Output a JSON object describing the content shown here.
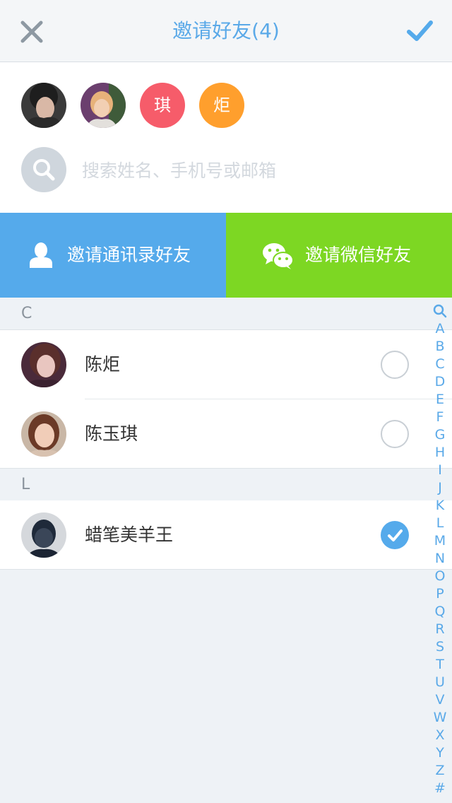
{
  "header": {
    "title": "邀请好友(4)"
  },
  "selected": {
    "chips": [
      {
        "type": "photo",
        "name": "avatar-photo-1"
      },
      {
        "type": "photo",
        "name": "avatar-photo-2"
      },
      {
        "type": "text",
        "text": "琪",
        "color": "#f65c6a"
      },
      {
        "type": "text",
        "text": "炬",
        "color": "#ff9f2d"
      }
    ]
  },
  "search": {
    "placeholder": "搜索姓名、手机号或邮箱"
  },
  "invite": {
    "contacts_label": "邀请通讯录好友",
    "wechat_label": "邀请微信好友"
  },
  "sections": [
    {
      "letter": "C",
      "contacts": [
        {
          "name": "陈炬",
          "checked": false
        },
        {
          "name": "陈玉琪",
          "checked": false
        }
      ]
    },
    {
      "letter": "L",
      "contacts": [
        {
          "name": "蜡笔美羊王",
          "checked": true
        }
      ]
    }
  ],
  "index_letters": [
    "A",
    "B",
    "C",
    "D",
    "E",
    "F",
    "G",
    "H",
    "I",
    "J",
    "K",
    "L",
    "M",
    "N",
    "O",
    "P",
    "Q",
    "R",
    "S",
    "T",
    "U",
    "V",
    "W",
    "X",
    "Y",
    "Z",
    "#"
  ],
  "colors": {
    "accent": "#55aaeb",
    "wechat": "#7dd723",
    "red_chip": "#f65c6a",
    "orange_chip": "#ff9f2d"
  }
}
